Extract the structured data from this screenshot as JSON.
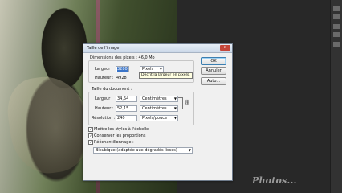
{
  "dialog": {
    "title": "Taille de l'image",
    "close_label": "x",
    "pixel_dimensions_label": "Dimensions des pixels : 46,0 Mo",
    "width_label": "Largeur :",
    "width_value": "3280",
    "width_unit": "Pixels",
    "height_label": "Hauteur :",
    "height_value": "4928",
    "tooltip": "Décrit la largeur en pixels.",
    "ok_label": "OK",
    "cancel_label": "Annuler",
    "auto_label": "Auto...",
    "document_size_label": "Taille du document :",
    "doc_width_label": "Largeur :",
    "doc_width_value": "34,54",
    "doc_width_unit": "Centimètres",
    "doc_height_label": "Hauteur :",
    "doc_height_value": "52,15",
    "doc_height_unit": "Centimètres",
    "resolution_label": "Résolution :",
    "resolution_value": "240",
    "resolution_unit": "Pixels/pouce",
    "scale_styles_label": "Mettre les styles à l'échelle",
    "constrain_label": "Conserver les proportions",
    "resample_label": "Rééchantillonnage :",
    "resample_method": "Bicubique (adaptée aux dégradés lisses)",
    "check_mark": "✓"
  },
  "watermark": "Photos...",
  "colors": {
    "accent": "#3a74c8",
    "tooltip_bg": "#ffffe1"
  }
}
